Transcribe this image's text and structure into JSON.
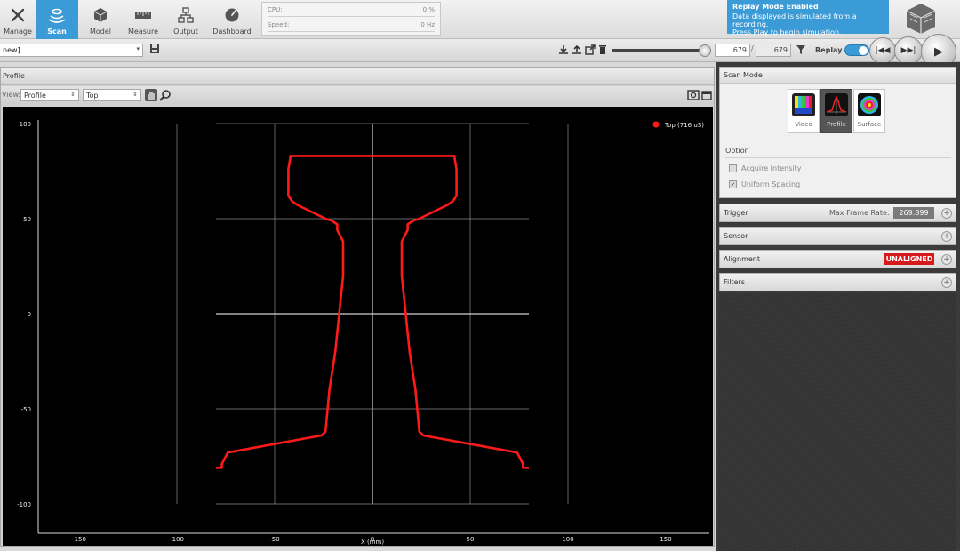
{
  "nav": {
    "items": [
      {
        "label": "Manage",
        "icon": "wrench-icon"
      },
      {
        "label": "Scan",
        "icon": "scan-icon",
        "active": true
      },
      {
        "label": "Model",
        "icon": "cube-icon"
      },
      {
        "label": "Measure",
        "icon": "ruler-icon"
      },
      {
        "label": "Output",
        "icon": "network-icon"
      },
      {
        "label": "Dashboard",
        "icon": "gauge-icon"
      }
    ]
  },
  "performance": {
    "cpu_label": "CPU:",
    "cpu_value": "0 %",
    "speed_label": "Speed:",
    "speed_value": "0 Hz"
  },
  "replay_notice": {
    "title": "Replay Mode Enabled",
    "line1": "Data displayed is simulated from a recording.",
    "line2": "Press Play to begin simulation."
  },
  "toolbar2": {
    "job_name": "new]",
    "frame_current": "679",
    "frame_separator": "/",
    "frame_total": "679",
    "replay_label": "Replay",
    "replay_enabled": true
  },
  "profile": {
    "title": "Profile",
    "view_label": "View:",
    "view_value": "Profile",
    "source_value": "Top"
  },
  "scan_mode": {
    "title": "Scan Mode",
    "modes": [
      "Video",
      "Profile",
      "Surface"
    ],
    "active_mode": "Profile",
    "option_title": "Option",
    "options": [
      {
        "label": "Acquire Intensity",
        "checked": false
      },
      {
        "label": "Uniform Spacing",
        "checked": true
      }
    ]
  },
  "sections": {
    "trigger": "Trigger",
    "max_rate_label": "Max Frame Rate:",
    "max_rate_value": "269.899",
    "sensor": "Sensor",
    "alignment": "Alignment",
    "alignment_status": "UNALIGNED",
    "filters": "Filters"
  },
  "colors": {
    "accent": "#3a9bd6",
    "profile_red": "#ff1a1a",
    "status_red": "#d6191b"
  },
  "chart_data": {
    "type": "scatter",
    "xlabel": "X (mm)",
    "ylabel": "",
    "xlim": [
      -180,
      180
    ],
    "ylim": [
      -100,
      100
    ],
    "xticks": [
      -150,
      -100,
      -50,
      0,
      50,
      100,
      150
    ],
    "yticks": [
      100,
      50,
      0,
      -50,
      -100
    ],
    "legend": "top-right",
    "series": [
      {
        "name": "Top (716 uS)",
        "color": "#ff1a1a",
        "x": [
          -80,
          -77,
          -77,
          -74,
          -26,
          -24,
          -22,
          -19,
          -17,
          -15,
          -15,
          -18,
          -18,
          -21,
          -24,
          -38,
          -41,
          -43,
          -43,
          -42,
          -42,
          42,
          42,
          43,
          43,
          41,
          38,
          24,
          21,
          18,
          18,
          15,
          15,
          17,
          19,
          22,
          24,
          26,
          74,
          77,
          77,
          80
        ],
        "y": [
          -81,
          -81,
          -79,
          -73,
          -64,
          -62,
          -40,
          -20,
          0,
          20,
          38,
          44,
          47,
          49,
          50,
          57,
          59,
          62,
          76,
          82,
          83,
          83,
          82,
          76,
          62,
          59,
          57,
          50,
          49,
          47,
          44,
          38,
          20,
          0,
          -20,
          -40,
          -62,
          -64,
          -73,
          -79,
          -81,
          -81
        ]
      }
    ]
  }
}
